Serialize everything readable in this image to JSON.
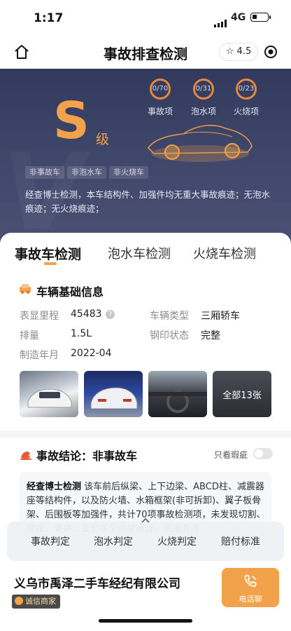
{
  "status": {
    "time": "1:17",
    "network": "4G"
  },
  "nav": {
    "title": "事故排查检测",
    "rating": "4.5"
  },
  "hero": {
    "grade": "S",
    "grade_unit": "级",
    "metrics": [
      {
        "value": "0/70",
        "label": "事故项"
      },
      {
        "value": "0/31",
        "label": "泡水项"
      },
      {
        "value": "0/23",
        "label": "火烧项"
      }
    ],
    "tags": [
      "非事故车",
      "非泡水车",
      "非火烧车"
    ],
    "description": "经查博士检测，本车结构件、加强件均无重大事故痕迹；无泡水痕迹；无火烧痕迹；"
  },
  "tabs": [
    "事故车检测",
    "泡水车检测",
    "火烧车检测"
  ],
  "info": {
    "title": "车辆基础信息",
    "rows": [
      {
        "label": "表显里程",
        "value": "45483"
      },
      {
        "label": "排量",
        "value": "1.5L"
      },
      {
        "label": "制造年月",
        "value": "2022-04"
      },
      {
        "label": "车辆类型",
        "value": "三厢轿车"
      },
      {
        "label": "钢印状态",
        "value": "完整"
      }
    ],
    "photos_more": "全部13张"
  },
  "conclusion": {
    "title": "事故结论：非事故车",
    "toggle_label": "只看瑕疵",
    "brand": "经查博士检测",
    "text": "该车前后纵梁、上下边梁、ABCD柱、减震器座等结构件，以及防火墙、水箱框架(非可拆卸)、翼子板骨架、后围板等加强件，共计70项事故检测项，未发现切割、焊接、更换、变形等全修复痕迹，依据查博"
  },
  "float_nav": [
    "事故判定",
    "泡水判定",
    "火烧判定",
    "赔付标准"
  ],
  "footer": {
    "company": "义乌市禹泽二手车经纪有限公司",
    "badge": "诚信商家",
    "call": "电话聊"
  },
  "colors": {
    "accent": "#f1a24a",
    "hero_bg": "#3c4468"
  }
}
